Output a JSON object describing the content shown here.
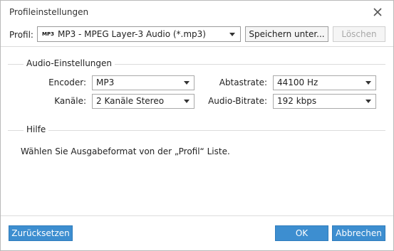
{
  "window": {
    "title": "Profileinstellungen"
  },
  "toolbar": {
    "profil_label": "Profil:",
    "profil_icon_text": "MP3",
    "profil_value": "MP3 - MPEG Layer-3 Audio (*.mp3)",
    "save_label": "Speichern unter...",
    "delete_label": "Löschen"
  },
  "audio": {
    "section_title": "Audio-Einstellungen",
    "encoder_label": "Encoder:",
    "encoder_value": "MP3",
    "channels_label": "Kanäle:",
    "channels_value": "2 Kanäle Stereo",
    "samplerate_label": "Abtastrate:",
    "samplerate_value": "44100 Hz",
    "bitrate_label": "Audio-Bitrate:",
    "bitrate_value": "192 kbps"
  },
  "help": {
    "section_title": "Hilfe",
    "text": "Wählen Sie Ausgabeformat von der „Profil“ Liste."
  },
  "footer": {
    "reset_label": "Zurücksetzen",
    "ok_label": "OK",
    "cancel_label": "Abbrechen"
  },
  "colors": {
    "accent": "#3d8ed0"
  }
}
